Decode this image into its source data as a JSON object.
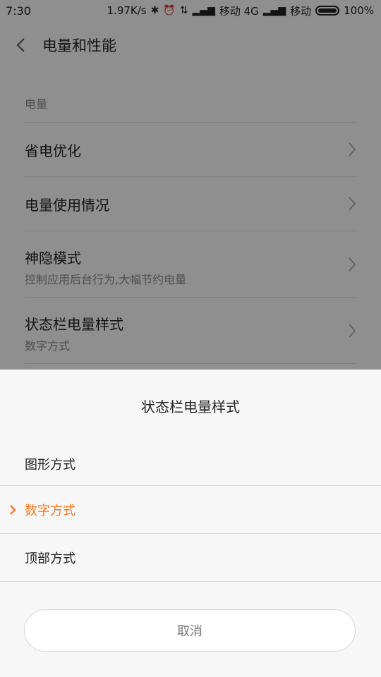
{
  "status_bar": {
    "time": "7:30",
    "speed": "1.97K/s",
    "carrier1": "移动 4G",
    "carrier2": "移动",
    "battery": "100%"
  },
  "header": {
    "title": "电量和性能"
  },
  "section": {
    "label": "电量"
  },
  "settings": [
    {
      "title": "省电优化"
    },
    {
      "title": "电量使用情况"
    },
    {
      "title": "神隐模式",
      "subtitle": "控制应用后台行为,大幅节约电量"
    },
    {
      "title": "状态栏电量样式",
      "subtitle": "数字方式"
    }
  ],
  "sheet": {
    "title": "状态栏电量样式",
    "options": [
      {
        "label": "图形方式",
        "selected": false
      },
      {
        "label": "数字方式",
        "selected": true
      },
      {
        "label": "顶部方式",
        "selected": false
      }
    ],
    "cancel_label": "取消"
  },
  "colors": {
    "accent": "#f07a28",
    "text": "#222222",
    "secondary": "#888888",
    "overlay": "rgba(0,0,0,0.42)"
  }
}
